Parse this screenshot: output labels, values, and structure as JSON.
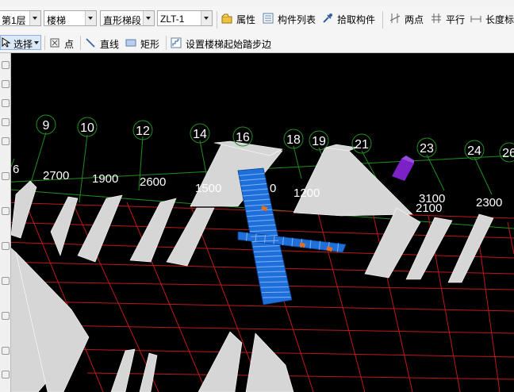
{
  "toolbar_top": {
    "floor": "第1层",
    "component_type": "楼梯",
    "sub_type": "直形梯段",
    "component_name": "ZLT-1",
    "buttons": {
      "properties": "属性",
      "component_list": "构件列表",
      "pick_component": "拾取构件",
      "two_points": "两点",
      "parallel": "平行",
      "length_label": "长度标"
    }
  },
  "toolbar_draw": {
    "select": "选择",
    "point": "点",
    "line": "直线",
    "rect": "矩形",
    "set_start_step": "设置楼梯起始踏步边"
  },
  "scene": {
    "axis_labels": [
      "9",
      "10",
      "12",
      "14",
      "16",
      "18",
      "19",
      "21",
      "23",
      "24",
      "26"
    ],
    "dimensions": [
      "6",
      "2700",
      "1900",
      "2600",
      "1500",
      "0",
      "1200",
      "3100",
      "2100",
      "2300"
    ],
    "colors": {
      "background": "#000000",
      "grid_red": "#c01818",
      "grid_green": "#1f8f1f",
      "stair_blue": "#1e6fd9",
      "column_purple": "#7a22c8",
      "wall_gray": "#d8d8d8"
    }
  }
}
